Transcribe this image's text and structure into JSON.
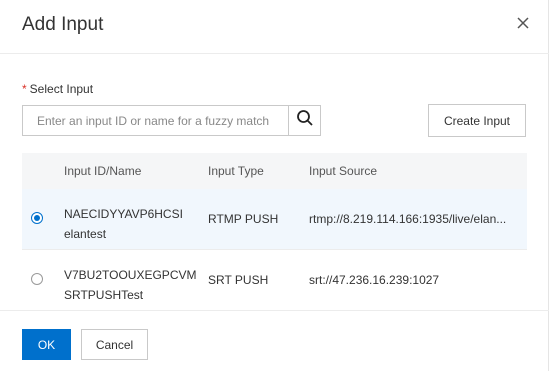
{
  "dialog": {
    "title": "Add Input",
    "close_icon": "close-icon"
  },
  "form": {
    "required_mark": "*",
    "label": "Select Input",
    "search": {
      "placeholder": "Enter an input ID or name for a fuzzy match",
      "value": "",
      "icon": "search-icon"
    },
    "create_label": "Create Input"
  },
  "table": {
    "headers": [
      "Input ID/Name",
      "Input Type",
      "Input Source"
    ],
    "rows": [
      {
        "selected": true,
        "id": "NAECIDYYAVP6HCSI",
        "name": "elantest",
        "type": "RTMP PUSH",
        "source": "rtmp://8.219.114.166:1935/live/elan..."
      },
      {
        "selected": false,
        "id": "V7BU2TOOUXEGPCVM",
        "name": "SRTPUSHTest",
        "type": "SRT PUSH",
        "source": "srt://47.236.16.239:1027"
      }
    ]
  },
  "footer": {
    "ok_label": "OK",
    "cancel_label": "Cancel"
  },
  "colors": {
    "primary": "#0070cc",
    "required": "#d93026",
    "selected_row": "#f1f7fd",
    "header_bg": "#f5f6f7"
  }
}
